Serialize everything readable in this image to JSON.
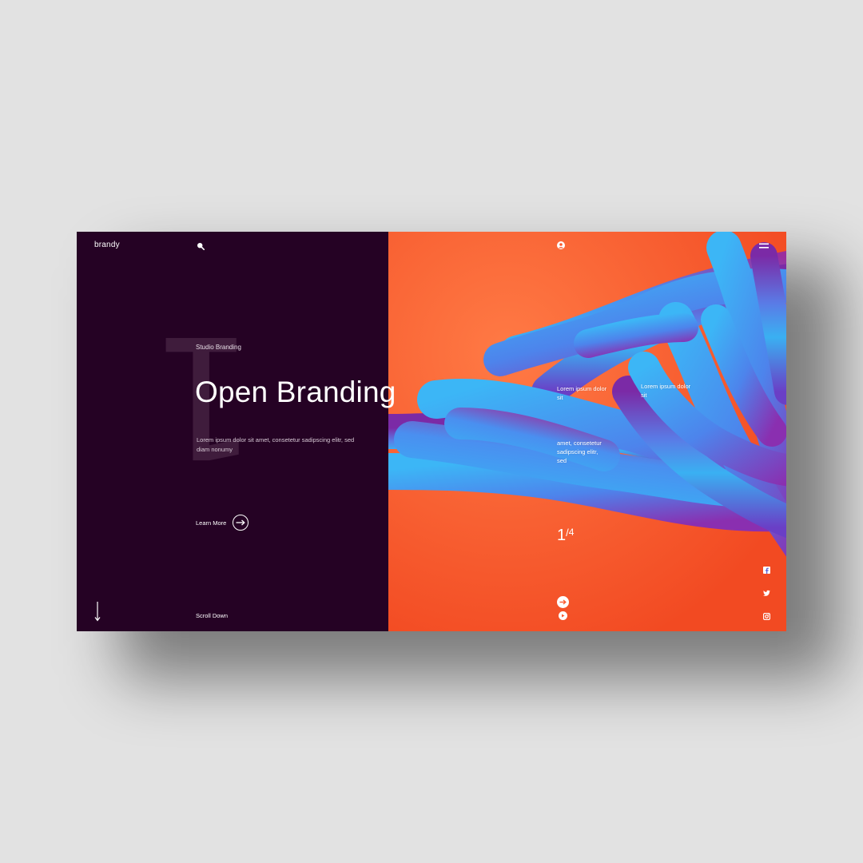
{
  "brand": {
    "logo": "brandy"
  },
  "hero": {
    "slide_number": "1",
    "eyebrow": "Studio Branding",
    "title": "Open Branding",
    "description": "Lorem ipsum dolor sit amet, consetetur sadipscing elitr, sed diam nonumy",
    "cta_label": "Learn More",
    "scroll_label": "Scroll Down"
  },
  "panel": {
    "caption_1": "Lorem ipsum dolor sit",
    "caption_2": "Lorem ipsum dolor sit",
    "caption_3": "amet, consetetur sadipscing elitr, sed",
    "counter": {
      "current": "1",
      "separator": "/",
      "total": "4"
    }
  },
  "icons": {
    "search": "search-icon",
    "user": "user-icon",
    "menu": "hamburger-menu-icon",
    "cta": "arrow-right-icon",
    "scroll": "arrow-down-icon",
    "next": "arrow-right-circle-icon",
    "play": "play-icon",
    "social": [
      "facebook-icon",
      "twitter-icon",
      "instagram-icon"
    ]
  },
  "colors": {
    "background": "#e2e2e2",
    "left_panel": "#250224",
    "right_panel": "#fb5a2f",
    "tube_blue": "#3aa8f0",
    "tube_purple": "#8a2fb0",
    "text": "#ffffff"
  }
}
